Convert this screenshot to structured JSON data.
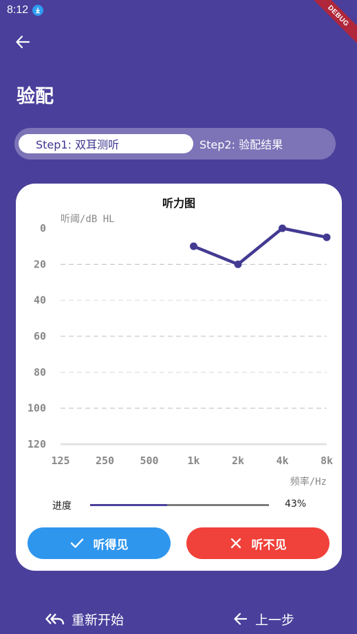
{
  "status_bar": {
    "time": "8:12",
    "debug_label": "DEBUG"
  },
  "header": {
    "title": "验配"
  },
  "steps": {
    "step1_label": "Step1: 双耳测听",
    "step2_label": "Step2: 验配结果"
  },
  "chart_data": {
    "type": "line",
    "title": "听力图",
    "ylabel": "听阈/dB HL",
    "xlabel": "频率/Hz",
    "categories": [
      "125",
      "250",
      "500",
      "1k",
      "2k",
      "4k",
      "8k"
    ],
    "y_ticks": [
      "0",
      "20",
      "40",
      "60",
      "80",
      "100",
      "120"
    ],
    "ylim": [
      0,
      120
    ],
    "y_inverted": true,
    "grid": true,
    "series": [
      {
        "values": [
          null,
          null,
          null,
          10,
          20,
          0,
          5
        ]
      }
    ]
  },
  "progress": {
    "label": "进度",
    "value_text": "43%",
    "fraction": 0.43
  },
  "buttons": {
    "hear": "听得见",
    "no_hear": "听不见"
  },
  "bottom_nav": {
    "restart": "重新开始",
    "previous": "上一步"
  },
  "colors": {
    "background": "#4a3f9b",
    "line": "#433a92",
    "hear_button": "#2f96ee",
    "no_hear_button": "#f0413a"
  }
}
